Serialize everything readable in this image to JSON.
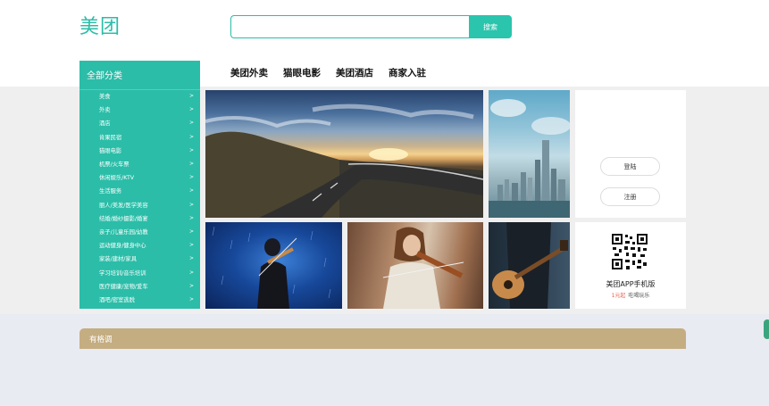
{
  "header": {
    "logo": "美团",
    "search": {
      "placeholder": "",
      "value": "",
      "button_label": "搜索"
    }
  },
  "nav": {
    "links": [
      "美团外卖",
      "猫眼电影",
      "美团酒店",
      "商家入驻"
    ]
  },
  "sidebar": {
    "title": "全部分类",
    "arrow": ">",
    "items": [
      "美食",
      "外卖",
      "酒店",
      "肯果民宿",
      "猫眼电影",
      "机票/火车票",
      "休闲娱乐/KTV",
      "生活服务",
      "丽人/美发/医学美容",
      "结婚/婚纱摄影/婚宴",
      "亲子/儿童乐园/幼教",
      "运动健身/健身中心",
      "家装/建材/家具",
      "学习培训/音乐培训",
      "医疗健康/宠物/爱车",
      "酒吧/密室逃脱"
    ]
  },
  "auth": {
    "login_label": "登陆",
    "register_label": "注册"
  },
  "app_promo": {
    "title": "美团APP手机版",
    "price": "1元起",
    "subtitle": "吃喝玩乐"
  },
  "section_bar": {
    "label": "有格调"
  },
  "colors": {
    "brand": "#2bbda8",
    "bar": "#c5ad82",
    "price": "#e8604c"
  }
}
